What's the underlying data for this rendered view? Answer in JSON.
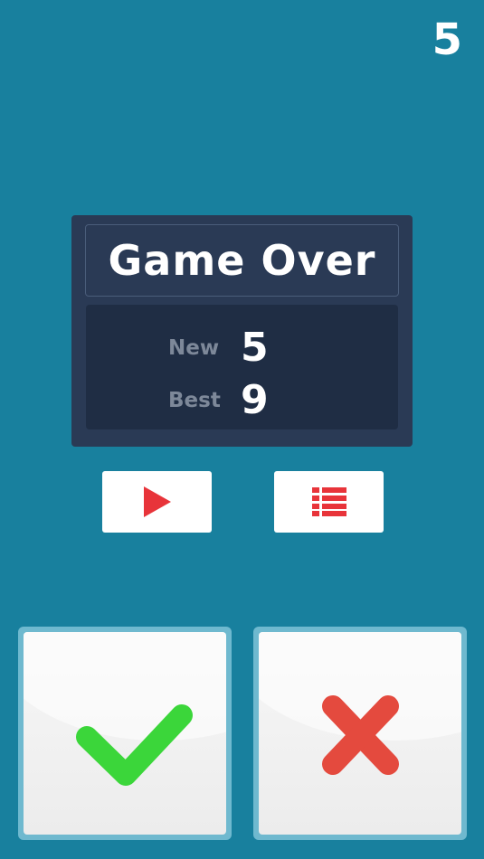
{
  "hud": {
    "current_score": "5"
  },
  "game_over": {
    "title": "Game Over",
    "new_label": "New",
    "new_value": "5",
    "best_label": "Best",
    "best_value": "9"
  },
  "menu": {
    "play_icon": "play-icon",
    "leaderboard_icon": "list-icon"
  },
  "answers": {
    "yes_icon": "check-icon",
    "no_icon": "cross-icon"
  },
  "colors": {
    "background": "#18809e",
    "panel": "#2a3a55",
    "accent_red": "#e8343a",
    "check_green": "#3bd63a",
    "cross_red": "#e44a3e"
  }
}
